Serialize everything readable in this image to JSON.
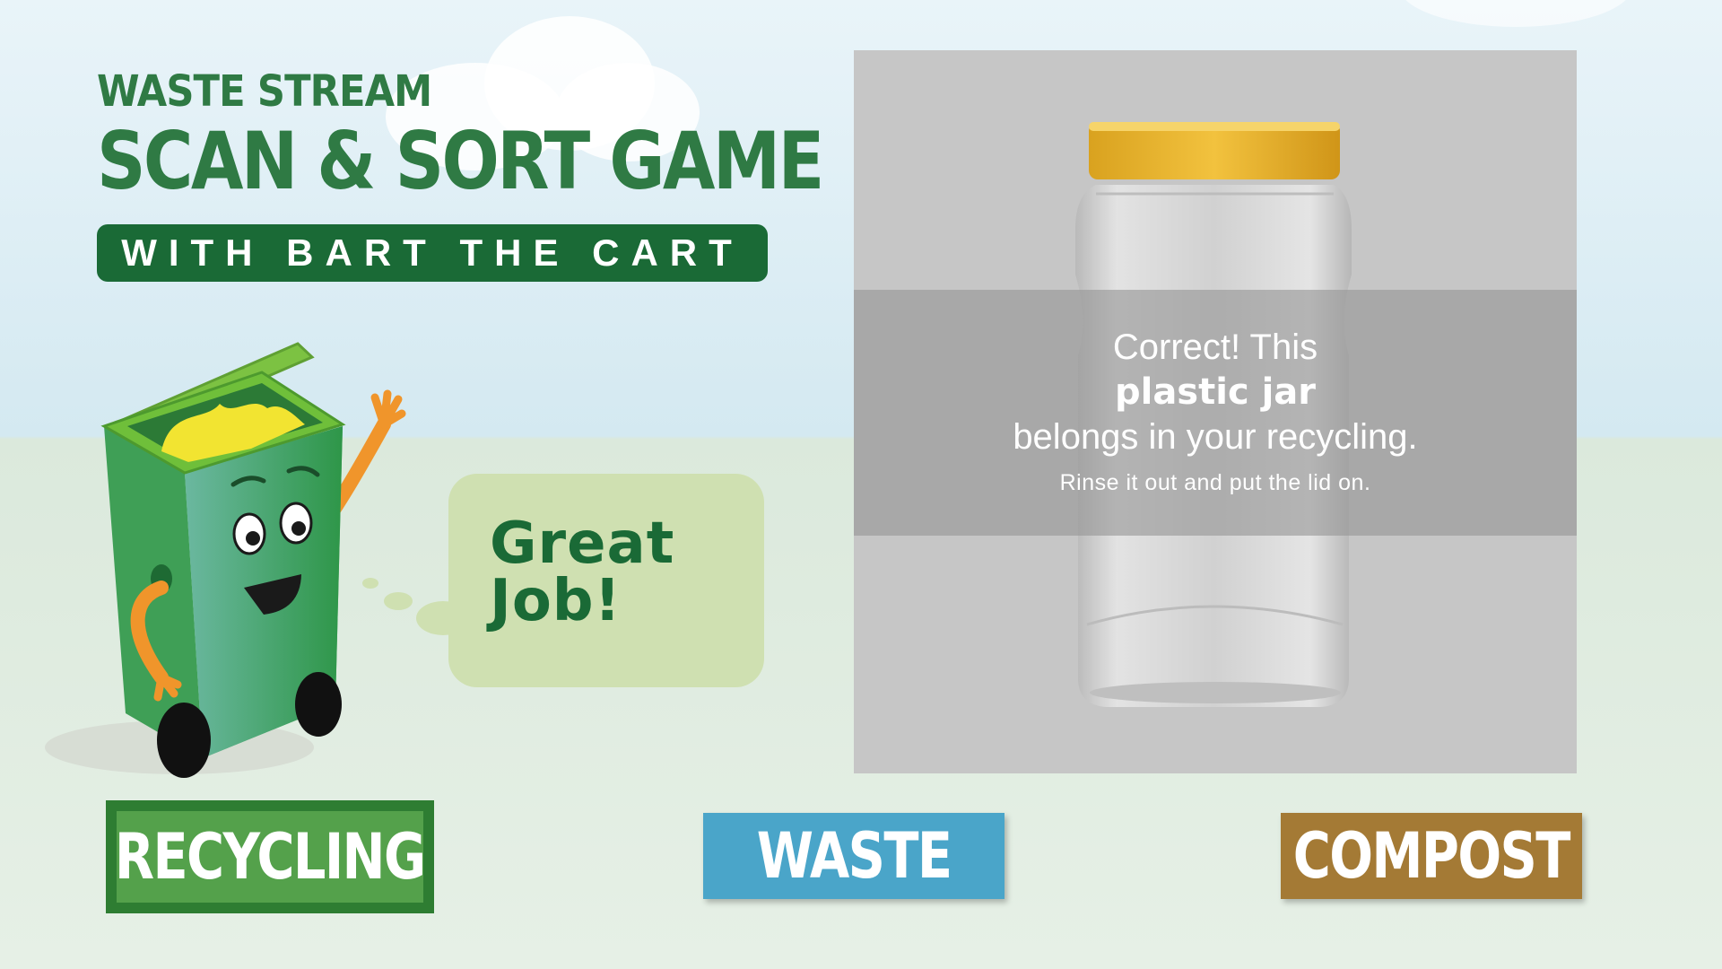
{
  "title": {
    "line1": "WASTE STREAM",
    "line2": "SCAN & SORT GAME",
    "subtitle": "WITH BART THE CART"
  },
  "mascot": {
    "name": "Bart the Cart",
    "speech": [
      "Great",
      "Job!"
    ]
  },
  "feedback": {
    "line1": "Correct! This",
    "item": "plastic jar",
    "line2": "belongs in your recycling.",
    "tip": "Rinse it out and put the lid on."
  },
  "bins": [
    {
      "label": "RECYCLING",
      "color": "#54a14b",
      "selected": true
    },
    {
      "label": "WASTE",
      "color": "#4aa5c9",
      "selected": false
    },
    {
      "label": "COMPOST",
      "color": "#a47a35",
      "selected": false
    }
  ],
  "icons": {
    "mascot": "green-recycling-cart-icon",
    "item": "plastic-jar-icon"
  }
}
